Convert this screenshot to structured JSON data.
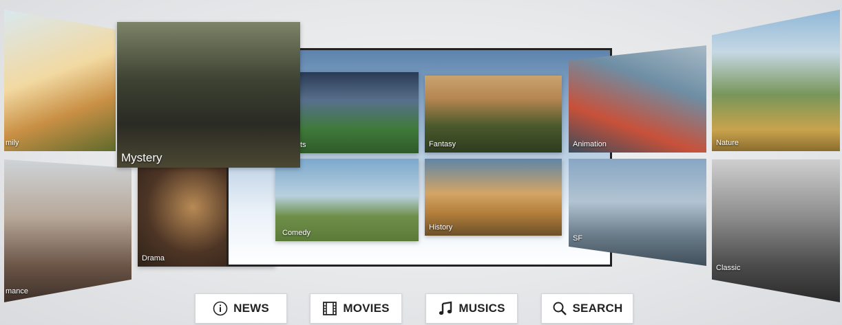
{
  "genres": {
    "family": "mily",
    "romance": "mance",
    "mystery": "Mystery",
    "drama": "Drama",
    "sports": "ts",
    "fantasy": "Fantasy",
    "animation": "Animation",
    "nature": "Nature",
    "comedy": "Comedy",
    "history": "History",
    "scifi": "SF",
    "classic": "Classic"
  },
  "nav": {
    "news": {
      "label": "NEWS",
      "icon": "info-circle-icon"
    },
    "movies": {
      "label": "MOVIES",
      "icon": "film-strip-icon"
    },
    "musics": {
      "label": "MUSICS",
      "icon": "music-note-icon"
    },
    "search": {
      "label": "SEARCH",
      "icon": "magnifier-icon"
    }
  }
}
